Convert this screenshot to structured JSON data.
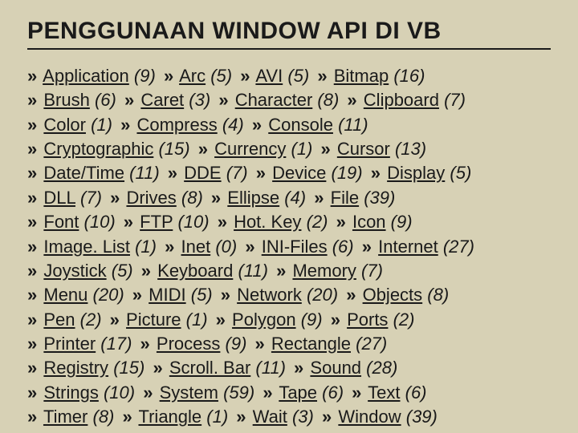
{
  "title": "PENGGUNAAN WINDOW API DI VB",
  "rows": [
    [
      {
        "label": "Application",
        "count": 9
      },
      {
        "label": "Arc",
        "count": 5
      },
      {
        "label": "AVI",
        "count": 5
      },
      {
        "label": "Bitmap",
        "count": 16
      }
    ],
    [
      {
        "label": "Brush",
        "count": 6
      },
      {
        "label": "Caret",
        "count": 3
      },
      {
        "label": "Character",
        "count": 8
      },
      {
        "label": "Clipboard",
        "count": 7
      }
    ],
    [
      {
        "label": "Color",
        "count": 1
      },
      {
        "label": "Compress",
        "count": 4
      },
      {
        "label": "Console",
        "count": 11
      }
    ],
    [
      {
        "label": "Cryptographic",
        "count": 15
      },
      {
        "label": "Currency",
        "count": 1
      },
      {
        "label": "Cursor",
        "count": 13
      }
    ],
    [
      {
        "label": "Date/Time",
        "count": 11
      },
      {
        "label": "DDE",
        "count": 7
      },
      {
        "label": "Device",
        "count": 19
      },
      {
        "label": "Display",
        "count": 5
      }
    ],
    [
      {
        "label": "DLL",
        "count": 7
      },
      {
        "label": "Drives",
        "count": 8
      },
      {
        "label": "Ellipse",
        "count": 4
      },
      {
        "label": "File",
        "count": 39
      }
    ],
    [
      {
        "label": "Font",
        "count": 10
      },
      {
        "label": "FTP",
        "count": 10
      },
      {
        "label": "Hot. Key",
        "count": 2
      },
      {
        "label": "Icon",
        "count": 9
      }
    ],
    [
      {
        "label": "Image. List",
        "count": 1
      },
      {
        "label": "Inet",
        "count": 0
      },
      {
        "label": "INI-Files",
        "count": 6
      },
      {
        "label": "Internet",
        "count": 27
      }
    ],
    [
      {
        "label": "Joystick",
        "count": 5
      },
      {
        "label": "Keyboard",
        "count": 11
      },
      {
        "label": "Memory",
        "count": 7
      }
    ],
    [
      {
        "label": "Menu",
        "count": 20
      },
      {
        "label": "MIDI",
        "count": 5
      },
      {
        "label": "Network",
        "count": 20
      },
      {
        "label": "Objects",
        "count": 8
      }
    ],
    [
      {
        "label": "Pen",
        "count": 2
      },
      {
        "label": "Picture",
        "count": 1
      },
      {
        "label": "Polygon",
        "count": 9
      },
      {
        "label": "Ports",
        "count": 2
      }
    ],
    [
      {
        "label": "Printer",
        "count": 17
      },
      {
        "label": "Process",
        "count": 9
      },
      {
        "label": "Rectangle",
        "count": 27
      }
    ],
    [
      {
        "label": "Registry",
        "count": 15
      },
      {
        "label": "Scroll. Bar",
        "count": 11
      },
      {
        "label": "Sound",
        "count": 28
      }
    ],
    [
      {
        "label": "Strings",
        "count": 10
      },
      {
        "label": "System",
        "count": 59
      },
      {
        "label": "Tape",
        "count": 6
      },
      {
        "label": "Text",
        "count": 6
      }
    ],
    [
      {
        "label": "Timer",
        "count": 8
      },
      {
        "label": "Triangle",
        "count": 1
      },
      {
        "label": "Wait",
        "count": 3
      },
      {
        "label": "Window",
        "count": 39
      }
    ]
  ]
}
